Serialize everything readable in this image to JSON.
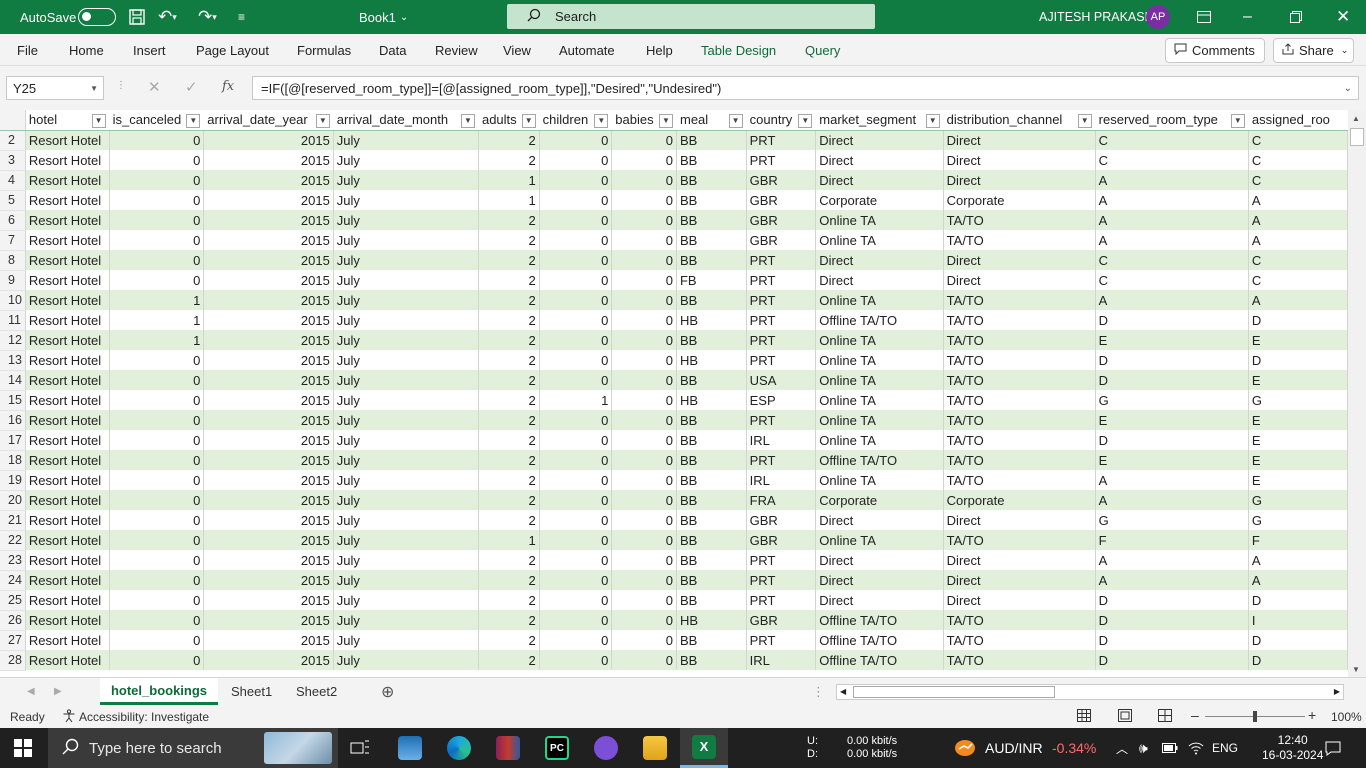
{
  "titlebar": {
    "autosave": "AutoSave",
    "book": "Book1",
    "search": "Search",
    "user": "AJITESH PRAKASH",
    "initials": "AP"
  },
  "ribbon": {
    "tabs": [
      "File",
      "Home",
      "Insert",
      "Page Layout",
      "Formulas",
      "Data",
      "Review",
      "View",
      "Automate",
      "Help",
      "Table Design",
      "Query"
    ],
    "comments": "Comments",
    "share": "Share"
  },
  "formula_bar": {
    "namebox": "Y25",
    "fx": "fx",
    "formula": "=IF([@[reserved_room_type]]=[@[assigned_room_type]],\"Desired\",\"Undesired\")"
  },
  "columns": [
    "hotel",
    "is_canceled",
    "arrival_date_year",
    "arrival_date_month",
    "adults",
    "children",
    "babies",
    "meal",
    "country",
    "market_segment",
    "distribution_channel",
    "reserved_room_type",
    "assigned_roo"
  ],
  "rows": [
    [
      "2",
      "Resort Hotel",
      "0",
      "2015",
      "July",
      "2",
      "0",
      "0",
      "BB",
      "PRT",
      "Direct",
      "Direct",
      "C",
      "C"
    ],
    [
      "3",
      "Resort Hotel",
      "0",
      "2015",
      "July",
      "2",
      "0",
      "0",
      "BB",
      "PRT",
      "Direct",
      "Direct",
      "C",
      "C"
    ],
    [
      "4",
      "Resort Hotel",
      "0",
      "2015",
      "July",
      "1",
      "0",
      "0",
      "BB",
      "GBR",
      "Direct",
      "Direct",
      "A",
      "C"
    ],
    [
      "5",
      "Resort Hotel",
      "0",
      "2015",
      "July",
      "1",
      "0",
      "0",
      "BB",
      "GBR",
      "Corporate",
      "Corporate",
      "A",
      "A"
    ],
    [
      "6",
      "Resort Hotel",
      "0",
      "2015",
      "July",
      "2",
      "0",
      "0",
      "BB",
      "GBR",
      "Online TA",
      "TA/TO",
      "A",
      "A"
    ],
    [
      "7",
      "Resort Hotel",
      "0",
      "2015",
      "July",
      "2",
      "0",
      "0",
      "BB",
      "GBR",
      "Online TA",
      "TA/TO",
      "A",
      "A"
    ],
    [
      "8",
      "Resort Hotel",
      "0",
      "2015",
      "July",
      "2",
      "0",
      "0",
      "BB",
      "PRT",
      "Direct",
      "Direct",
      "C",
      "C"
    ],
    [
      "9",
      "Resort Hotel",
      "0",
      "2015",
      "July",
      "2",
      "0",
      "0",
      "FB",
      "PRT",
      "Direct",
      "Direct",
      "C",
      "C"
    ],
    [
      "10",
      "Resort Hotel",
      "1",
      "2015",
      "July",
      "2",
      "0",
      "0",
      "BB",
      "PRT",
      "Online TA",
      "TA/TO",
      "A",
      "A"
    ],
    [
      "11",
      "Resort Hotel",
      "1",
      "2015",
      "July",
      "2",
      "0",
      "0",
      "HB",
      "PRT",
      "Offline TA/TO",
      "TA/TO",
      "D",
      "D"
    ],
    [
      "12",
      "Resort Hotel",
      "1",
      "2015",
      "July",
      "2",
      "0",
      "0",
      "BB",
      "PRT",
      "Online TA",
      "TA/TO",
      "E",
      "E"
    ],
    [
      "13",
      "Resort Hotel",
      "0",
      "2015",
      "July",
      "2",
      "0",
      "0",
      "HB",
      "PRT",
      "Online TA",
      "TA/TO",
      "D",
      "D"
    ],
    [
      "14",
      "Resort Hotel",
      "0",
      "2015",
      "July",
      "2",
      "0",
      "0",
      "BB",
      "USA",
      "Online TA",
      "TA/TO",
      "D",
      "E"
    ],
    [
      "15",
      "Resort Hotel",
      "0",
      "2015",
      "July",
      "2",
      "1",
      "0",
      "HB",
      "ESP",
      "Online TA",
      "TA/TO",
      "G",
      "G"
    ],
    [
      "16",
      "Resort Hotel",
      "0",
      "2015",
      "July",
      "2",
      "0",
      "0",
      "BB",
      "PRT",
      "Online TA",
      "TA/TO",
      "E",
      "E"
    ],
    [
      "17",
      "Resort Hotel",
      "0",
      "2015",
      "July",
      "2",
      "0",
      "0",
      "BB",
      "IRL",
      "Online TA",
      "TA/TO",
      "D",
      "E"
    ],
    [
      "18",
      "Resort Hotel",
      "0",
      "2015",
      "July",
      "2",
      "0",
      "0",
      "BB",
      "PRT",
      "Offline TA/TO",
      "TA/TO",
      "E",
      "E"
    ],
    [
      "19",
      "Resort Hotel",
      "0",
      "2015",
      "July",
      "2",
      "0",
      "0",
      "BB",
      "IRL",
      "Online TA",
      "TA/TO",
      "A",
      "E"
    ],
    [
      "20",
      "Resort Hotel",
      "0",
      "2015",
      "July",
      "2",
      "0",
      "0",
      "BB",
      "FRA",
      "Corporate",
      "Corporate",
      "A",
      "G"
    ],
    [
      "21",
      "Resort Hotel",
      "0",
      "2015",
      "July",
      "2",
      "0",
      "0",
      "BB",
      "GBR",
      "Direct",
      "Direct",
      "G",
      "G"
    ],
    [
      "22",
      "Resort Hotel",
      "0",
      "2015",
      "July",
      "1",
      "0",
      "0",
      "BB",
      "GBR",
      "Online TA",
      "TA/TO",
      "F",
      "F"
    ],
    [
      "23",
      "Resort Hotel",
      "0",
      "2015",
      "July",
      "2",
      "0",
      "0",
      "BB",
      "PRT",
      "Direct",
      "Direct",
      "A",
      "A"
    ],
    [
      "24",
      "Resort Hotel",
      "0",
      "2015",
      "July",
      "2",
      "0",
      "0",
      "BB",
      "PRT",
      "Direct",
      "Direct",
      "A",
      "A"
    ],
    [
      "25",
      "Resort Hotel",
      "0",
      "2015",
      "July",
      "2",
      "0",
      "0",
      "BB",
      "PRT",
      "Direct",
      "Direct",
      "D",
      "D"
    ],
    [
      "26",
      "Resort Hotel",
      "0",
      "2015",
      "July",
      "2",
      "0",
      "0",
      "HB",
      "GBR",
      "Offline TA/TO",
      "TA/TO",
      "D",
      "I"
    ],
    [
      "27",
      "Resort Hotel",
      "0",
      "2015",
      "July",
      "2",
      "0",
      "0",
      "BB",
      "PRT",
      "Offline TA/TO",
      "TA/TO",
      "D",
      "D"
    ],
    [
      "28",
      "Resort Hotel",
      "0",
      "2015",
      "July",
      "2",
      "0",
      "0",
      "BB",
      "IRL",
      "Offline TA/TO",
      "TA/TO",
      "D",
      "D"
    ]
  ],
  "sheets": [
    "hotel_bookings",
    "Sheet1",
    "Sheet2"
  ],
  "status": {
    "ready": "Ready",
    "accessibility": "Accessibility: Investigate",
    "zoom": "100%"
  },
  "taskbar": {
    "search": "Type here to search",
    "net_u_label": "U:",
    "net_d_label": "D:",
    "net_u": "0.00 kbit/s",
    "net_d": "0.00 kbit/s",
    "currency": "AUD/INR",
    "change": "-0.34%",
    "lang": "ENG",
    "time": "12:40",
    "date": "16-03-2024"
  },
  "colors": {
    "excel_green": "#107c41",
    "band": "#e2efda",
    "negative": "#ff6b6b"
  }
}
